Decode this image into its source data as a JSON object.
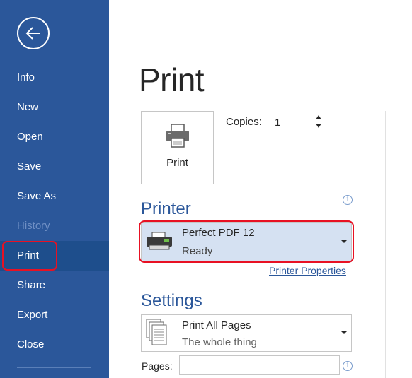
{
  "sidebar": {
    "items": [
      {
        "label": "Info"
      },
      {
        "label": "New"
      },
      {
        "label": "Open"
      },
      {
        "label": "Save"
      },
      {
        "label": "Save As"
      },
      {
        "label": "History"
      },
      {
        "label": "Print"
      },
      {
        "label": "Share"
      },
      {
        "label": "Export"
      },
      {
        "label": "Close"
      }
    ],
    "disabled_item": "History",
    "selected_item": "Print"
  },
  "main": {
    "title": "Print",
    "print_button_label": "Print",
    "copies": {
      "label": "Copies:",
      "value": "1"
    },
    "printer": {
      "heading": "Printer",
      "selected_name": "Perfect PDF 12",
      "selected_status": "Ready",
      "properties_link": "Printer Properties"
    },
    "settings": {
      "heading": "Settings",
      "page_range": {
        "label": "Print All Pages",
        "description": "The whole thing"
      },
      "pages_label": "Pages:",
      "pages_value": ""
    }
  },
  "colors": {
    "sidebar_bg": "#2b579a",
    "sidebar_selected": "#1e4e8c",
    "accent": "#2b579a",
    "highlight": "#e81123",
    "printer_select_bg": "#d5e1f2"
  },
  "icons": [
    "back-arrow-icon",
    "printer-icon",
    "info-icon",
    "pages-icon",
    "chevron-down-icon"
  ]
}
